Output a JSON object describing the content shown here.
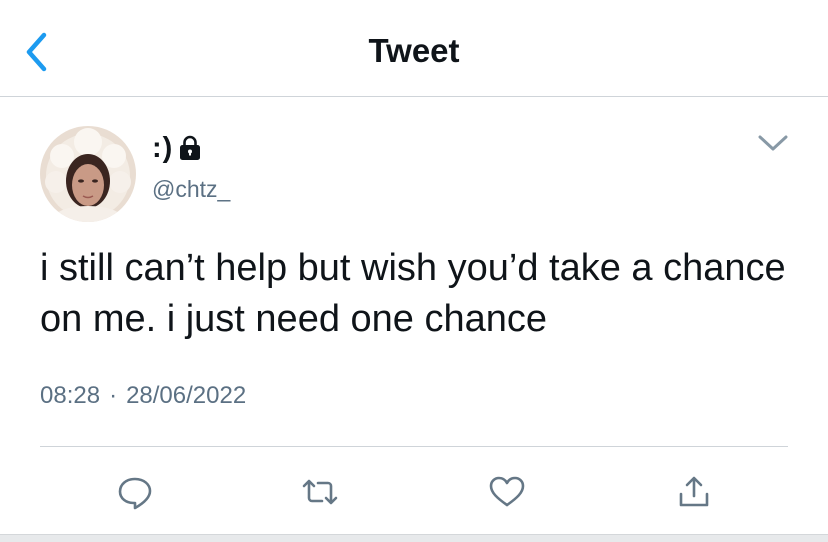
{
  "header": {
    "title": "Tweet",
    "back_icon": "chevron-left-icon"
  },
  "author": {
    "display_name": ":)",
    "handle": "@chtz_",
    "protected_icon": "lock-icon"
  },
  "tweet": {
    "text": "i still can’t help but wish you’d take a chance on me. i just need one chance",
    "time": "08:28",
    "separator": "·",
    "date": "28/06/2022"
  },
  "actions": [
    {
      "name": "reply",
      "icon": "comment-bubble-icon"
    },
    {
      "name": "retweet",
      "icon": "retweet-icon"
    },
    {
      "name": "like",
      "icon": "heart-icon"
    },
    {
      "name": "share",
      "icon": "share-icon"
    }
  ],
  "colors": {
    "accent": "#1d9bf0",
    "text_primary": "#0f1419",
    "text_secondary": "#5b7083",
    "icon_gray": "#657786",
    "divider": "#cfd4d9"
  }
}
